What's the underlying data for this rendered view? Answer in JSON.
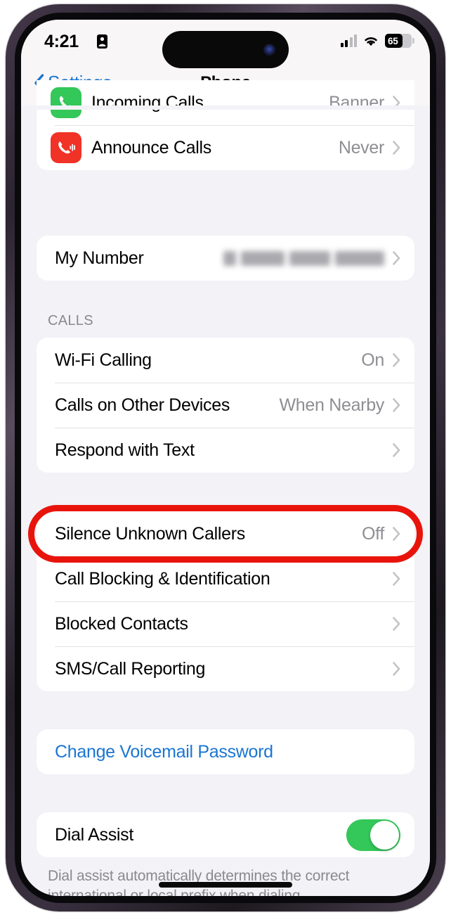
{
  "status_bar": {
    "time": "4:21",
    "lock_icon": "person-lock-icon",
    "cellular_icon": "cellular-signal-icon",
    "wifi_icon": "wifi-icon",
    "battery_level": "65",
    "battery_icon": "battery-icon"
  },
  "nav": {
    "back_label": "Settings",
    "back_icon": "chevron-left-icon",
    "title": "Phone"
  },
  "groups": {
    "notifications": {
      "rows": [
        {
          "label": "Incoming Calls",
          "value": "Banner",
          "icon": "phone-green-icon",
          "clipped": true
        },
        {
          "label": "Announce Calls",
          "value": "Never",
          "icon": "announce-calls-red-icon",
          "clipped": false
        }
      ]
    },
    "my_number": {
      "rows": [
        {
          "label": "My Number",
          "value": "",
          "redacted": true
        }
      ]
    },
    "calls": {
      "header": "CALLS",
      "rows": [
        {
          "label": "Wi-Fi Calling",
          "value": "On"
        },
        {
          "label": "Calls on Other Devices",
          "value": "When Nearby"
        },
        {
          "label": "Respond with Text",
          "value": ""
        }
      ]
    },
    "blocking": {
      "rows": [
        {
          "label": "Silence Unknown Callers",
          "value": "Off",
          "highlighted": true
        },
        {
          "label": "Call Blocking & Identification",
          "value": ""
        },
        {
          "label": "Blocked Contacts",
          "value": ""
        },
        {
          "label": "SMS/Call Reporting",
          "value": ""
        }
      ]
    },
    "voicemail": {
      "rows": [
        {
          "label": "Change Voicemail Password"
        }
      ]
    },
    "dial_assist": {
      "rows": [
        {
          "label": "Dial Assist",
          "toggle_state": "on"
        }
      ],
      "footer": "Dial assist automatically determines the correct international or local prefix when dialing."
    }
  },
  "annotation": {
    "target": "Silence Unknown Callers",
    "color": "#e8140c",
    "shape": "oval-outline"
  },
  "colors": {
    "accent_blue": "#1a75d2",
    "toggle_green": "#34c759",
    "icon_red": "#f03227",
    "icon_green": "#34c759",
    "background": "#f2f2f7",
    "annotation_red": "#e8140c"
  }
}
